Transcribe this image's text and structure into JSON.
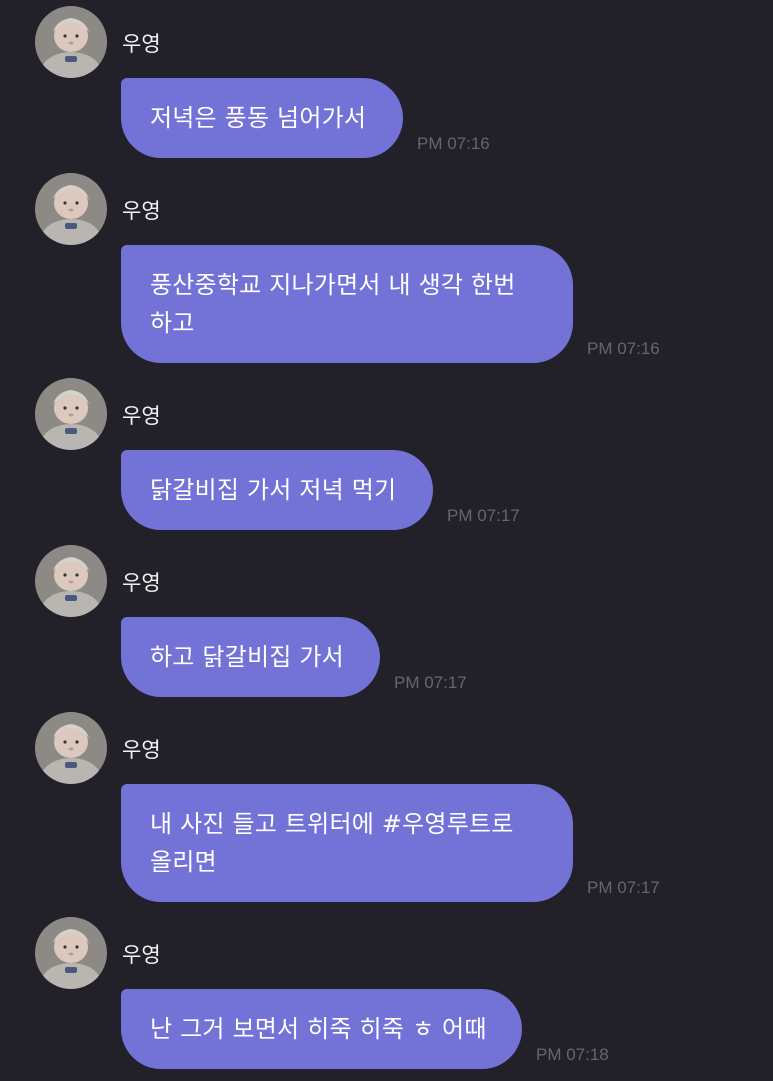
{
  "colors": {
    "background": "#222129",
    "bubble": "#7372d6",
    "sender_text": "#f2f2f5",
    "timestamp_text": "#66656e"
  },
  "messages": [
    {
      "sender": "우영",
      "text": "저녁은 풍동 넘어가서",
      "time": "PM 07:16",
      "avatar_icon": "baby-photo-avatar"
    },
    {
      "sender": "우영",
      "text": "풍산중학교 지나가면서 내 생각 한번\n하고",
      "time": "PM 07:16",
      "avatar_icon": "baby-photo-avatar"
    },
    {
      "sender": "우영",
      "text": "닭갈비집 가서 저녁 먹기",
      "time": "PM 07:17",
      "avatar_icon": "baby-photo-avatar"
    },
    {
      "sender": "우영",
      "text": "하고 닭갈비집 가서",
      "time": "PM 07:17",
      "avatar_icon": "baby-photo-avatar"
    },
    {
      "sender": "우영",
      "text": "내 사진 들고 트위터에 #우영루트로\n올리면",
      "time": "PM 07:17",
      "avatar_icon": "baby-photo-avatar"
    },
    {
      "sender": "우영",
      "text": "난 그거 보면서 히죽 히죽 ㅎ 어때",
      "time": "PM 07:18",
      "avatar_icon": "baby-photo-avatar"
    }
  ]
}
